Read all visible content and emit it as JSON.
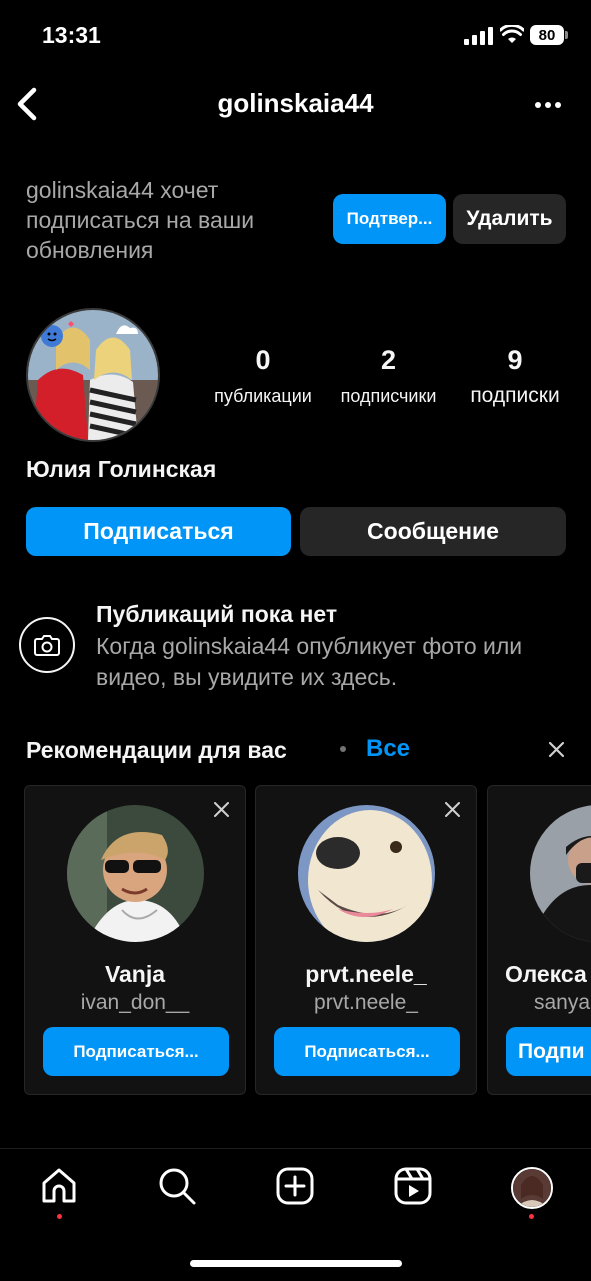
{
  "status": {
    "time": "13:31",
    "battery": "80"
  },
  "header": {
    "username": "golinskaia44"
  },
  "request": {
    "text": "golinskaia44 хочет подписаться на ваши обновления",
    "confirm_label": "Подтвер...",
    "delete_label": "Удалить"
  },
  "profile": {
    "stats": [
      {
        "value": "0",
        "label": "публикации"
      },
      {
        "value": "2",
        "label": "подписчики"
      },
      {
        "value": "9",
        "label": "подписки"
      }
    ],
    "full_name": "Юлия Голинская",
    "follow_label": "Подписаться",
    "message_label": "Сообщение"
  },
  "empty": {
    "title": "Публикаций пока нет",
    "subtitle": "Когда golinskaia44 опубликует фото или видео, вы увидите их здесь."
  },
  "recommendations": {
    "title": "Рекомендации для вас",
    "see_all": "Все",
    "cards": [
      {
        "name": "Vanja",
        "username": "ivan_don__",
        "button": "Подписаться..."
      },
      {
        "name": "prvt.neele_",
        "username": "prvt.neele_",
        "button": "Подписаться..."
      },
      {
        "name": "Олекса",
        "username": "sanya",
        "button": "Подпи"
      }
    ]
  },
  "tabs": [
    "home-icon",
    "search-icon",
    "create-icon",
    "reels-icon",
    "profile-avatar"
  ],
  "colors": {
    "accent": "#0095f6",
    "secondary_button": "#262626",
    "notification_dot": "#ff3040"
  }
}
